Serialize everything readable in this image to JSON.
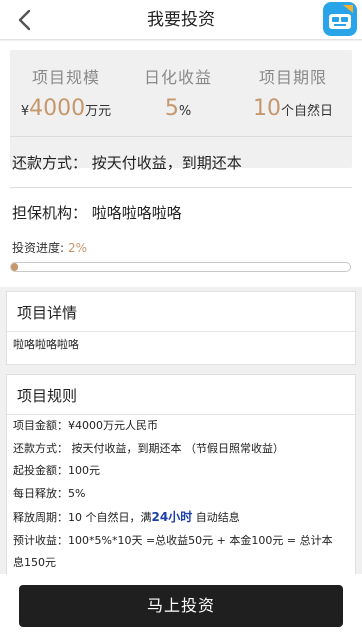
{
  "header": {
    "title": "我要投资"
  },
  "summary": {
    "stats": [
      {
        "label": "项目规模",
        "prefix": "¥",
        "value": "4000",
        "unit": "万元"
      },
      {
        "label": "日化收益",
        "value": "5",
        "unit": "%"
      },
      {
        "label": "项目期限",
        "value": "10",
        "unit": "个自然日"
      }
    ],
    "repayment": "还款方式：  按天付收益，到期还本",
    "guarantee": "担保机构：  啦咯啦咯啦咯",
    "progress_label": "投资进度:",
    "progress_text": "2%",
    "progress_value": 0.02
  },
  "detail": {
    "title": "项目详情",
    "text": "啦咯啦咯啦咯"
  },
  "rules": {
    "title": "项目规则",
    "lines": [
      "项目金额：¥4000万元人民币",
      "还款方式：  按天付收益，到期还本  （节假日照常收益）",
      "起投金额：100元",
      "每日释放：5%",
      "预计收益：100*5%*10天 =总收益50元 + 本金100元 = 总计本",
      "息150元"
    ],
    "period_prefix": "释放周期：10 个自然日，满",
    "period_highlight": "24小时",
    "period_suffix": " 自动结息"
  },
  "button": {
    "label": "马上投资"
  },
  "colors": {
    "accent": "#c7976c",
    "button_bg": "#1f1f1f",
    "highlight": "#1a3fa8"
  }
}
